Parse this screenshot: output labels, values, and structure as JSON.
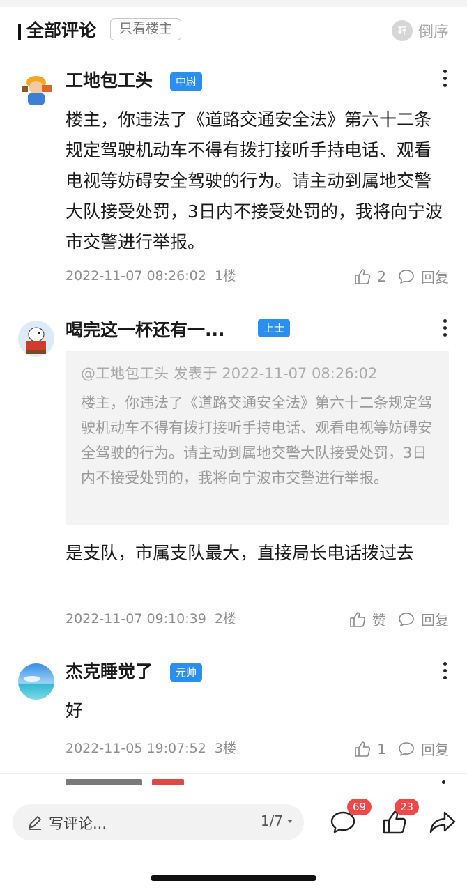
{
  "header": {
    "title": "全部评论",
    "only_op_label": "只看楼主",
    "sort_label": "倒序"
  },
  "comments": [
    {
      "username": "工地包工头",
      "badge": "中尉",
      "text": "楼主，你违法了《道路交通安全法》第六十二条规定驾驶机动车不得有拨打接听手持电话、观看电视等妨碍安全驾驶的行为。请主动到属地交警大队接受处罚，3日内不接受处罚的，我将向宁波市交警进行举报。",
      "time": "2022-11-07 08:26:02",
      "floor": "1楼",
      "likes": "2",
      "reply_label": "回复"
    },
    {
      "username": "喝完这一杯还有一...",
      "badge": "上士",
      "quote_header": "@工地包工头 发表于 2022-11-07 08:26:02",
      "quote_text": "楼主，你违法了《道路交通安全法》第六十二条规定驾驶机动车不得有拨打接听手持电话、观看电视等妨碍安全驾驶的行为。请主动到属地交警大队接受处罚，3日内不接受处罚的，我将向宁波市交警进行举报。",
      "text": "是支队，市属支队最大，直接局长电话拨过去",
      "time": "2022-11-07 09:10:39",
      "floor": "2楼",
      "likes": "赞",
      "reply_label": "回复"
    },
    {
      "username": "杰克睡觉了",
      "badge": "元帅",
      "text": "好",
      "time": "2022-11-05 19:07:52",
      "floor": "3楼",
      "likes": "1",
      "reply_label": "回复"
    }
  ],
  "bottom": {
    "input_placeholder": "写评论...",
    "page_indicator": "1/7",
    "comment_count": "69",
    "like_count": "23"
  },
  "colors": {
    "badge_blue": "#2b8ff0",
    "count_red": "#f04848",
    "meta_gray": "#8e8e8e"
  }
}
